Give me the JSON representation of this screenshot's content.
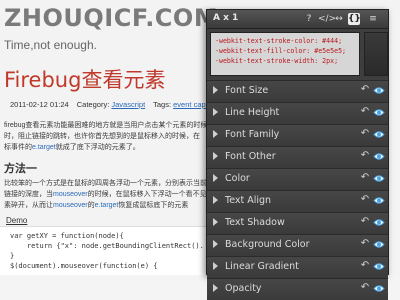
{
  "site": {
    "title": "ZHOUQICF.COM",
    "tagline": "Time,not enough."
  },
  "post": {
    "title": "Firebug查看元素",
    "date": "2011-02-12 01:24",
    "category_label": "Category:",
    "category": "Javascript",
    "tags_label": "Tags:",
    "tags": "event capture",
    "p1_line1": "firebug查看元素功能最困难的地方就是当用户点击某个元素的时候",
    "p1_line2": "时，阻止链接的跳转，也许你首先想到的是鼠标移入的时候，在",
    "p1_line3_pre": "标事件的",
    "p1_line3_link": "e.target",
    "p1_line3_post": "就成了底下浮动的元素了。",
    "section_heading": "方法一",
    "p2_line1": "比较笨的一个方式是在鼠标的四周各浮动一个元素，分别表示当前",
    "p2_line2": "链接的深度，当",
    "p2_line2_link": "mouseover",
    "p2_line2_post": "的时候，在鼠标移入下浮动一个看不见",
    "p2_line3_pre": "素碎开，从而让",
    "p2_line3_link1": "mouseover",
    "p2_line3_mid": "的",
    "p2_line3_link2": "e.target",
    "p2_line3_post": "恢复成鼠标底下的元素",
    "demo_label": "Demo",
    "code": "var getXY = function(node){\n    return {\"x\": node.getBoundingClientRect().\n}\n$(document).mouseover(function(e) {"
  },
  "panel": {
    "toolbar_label": "A x 1",
    "toolbar_buttons": [
      "?",
      "</>",
      "↔",
      "{}",
      "≡"
    ],
    "css_code": "-webkit-text-stroke-color: #444;\n-webkit-text-fill-color: #e5e5e5;\n-webkit-text-stroke-width: 2px;",
    "sections": [
      "Font Size",
      "Line Height",
      "Font Family",
      "Font Other",
      "Color",
      "Text Align",
      "Text Shadow",
      "Background Color",
      "Linear Gradient",
      "Opacity"
    ]
  },
  "colors": {
    "post_title": "#c0392b",
    "link": "#2a6ab8",
    "panel_bg": "#3e3e3e",
    "css_code_text": "#b8191e",
    "eye_icon": "#4aa3df"
  }
}
